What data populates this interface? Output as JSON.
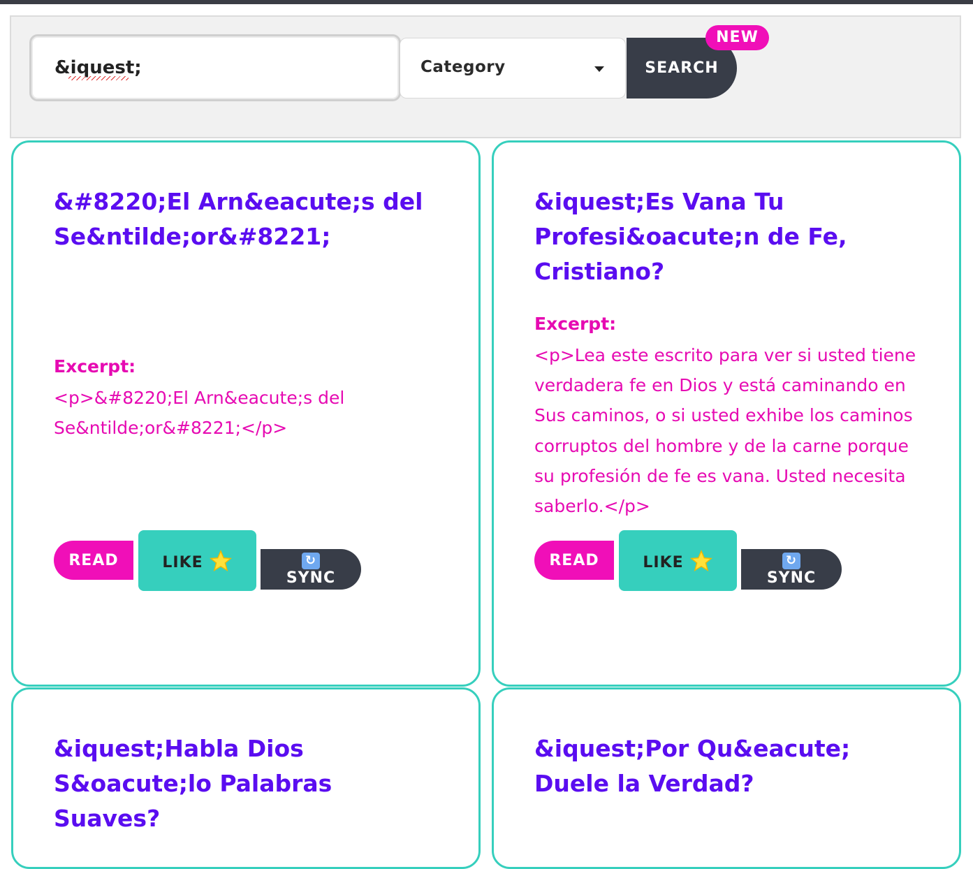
{
  "search": {
    "query": "&iquest;",
    "category_label": "Category",
    "button_label": "SEARCH",
    "badge": "NEW"
  },
  "cards": [
    {
      "title": "&#8220;El Arn&eacute;s del Se&ntilde;or&#8221;",
      "excerpt_label": "Excerpt:",
      "excerpt": "<p>&#8220;El Arn&eacute;s del Se&ntilde;or&#8221;</p>",
      "read": "READ",
      "like": "LIKE",
      "sync": "SYNC"
    },
    {
      "title": "&iquest;Es Vana Tu Profesi&oacute;n de Fe, Cristiano?",
      "excerpt_label": "Excerpt:",
      "excerpt": "<p>Lea este escrito para ver si usted tiene verdadera fe en Dios y está caminando en Sus caminos, o si usted exhibe los caminos corruptos del hombre y de la carne porque su profesión de fe es vana. Usted necesita saberlo.</p>",
      "read": "READ",
      "like": "LIKE",
      "sync": "SYNC"
    },
    {
      "title": "&iquest;Habla Dios S&oacute;lo Palabras Suaves?"
    },
    {
      "title": "&iquest;Por Qu&eacute; Duele la Verdad?"
    }
  ],
  "icons": {
    "like": "star-icon",
    "sync": "sync-icon"
  },
  "colors": {
    "accent_teal": "#36cfbd",
    "accent_pink": "#f00fb8",
    "title_purple": "#5a0df0",
    "dark": "#383d48"
  }
}
